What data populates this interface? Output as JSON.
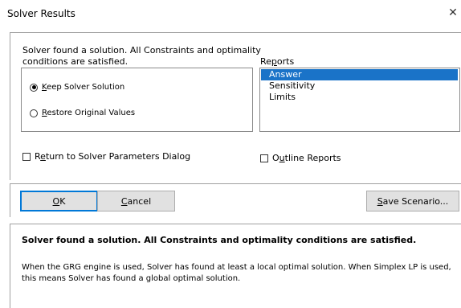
{
  "window": {
    "title": "Solver Results",
    "close_glyph": "✕"
  },
  "message": "Solver found a solution.  All Constraints and optimality conditions are satisfied.",
  "options": [
    {
      "label_pre": "",
      "accel": "K",
      "label_post": "eep Solver Solution",
      "selected": true
    },
    {
      "label_pre": "",
      "accel": "R",
      "label_post": "estore Original Values",
      "selected": false
    }
  ],
  "reports": {
    "label_pre": "Re",
    "label_accel": "p",
    "label_post": "orts",
    "items": [
      "Answer",
      "Sensitivity",
      "Limits"
    ],
    "selected_index": 0
  },
  "return_checkbox": {
    "pre": "R",
    "accel": "e",
    "post": "turn to Solver Parameters Dialog",
    "checked": false
  },
  "outline_checkbox": {
    "pre": "O",
    "accel": "u",
    "post": "tline Reports",
    "checked": false
  },
  "buttons": {
    "ok": {
      "pre": "",
      "accel": "O",
      "post": "K"
    },
    "cancel": {
      "pre": "",
      "accel": "C",
      "post": "ancel"
    },
    "save": {
      "pre": "",
      "accel": "S",
      "post": "ave Scenario..."
    }
  },
  "info": {
    "heading": "Solver found a solution.  All Constraints and optimality conditions are satisfied.",
    "body": "When the GRG engine is used, Solver has found at least a local optimal solution. When Simplex LP is used, this means Solver has found a global optimal solution."
  },
  "colors": {
    "selection": "#1a73c8",
    "button_bg": "#e1e1e1",
    "default_border": "#0078d7"
  }
}
